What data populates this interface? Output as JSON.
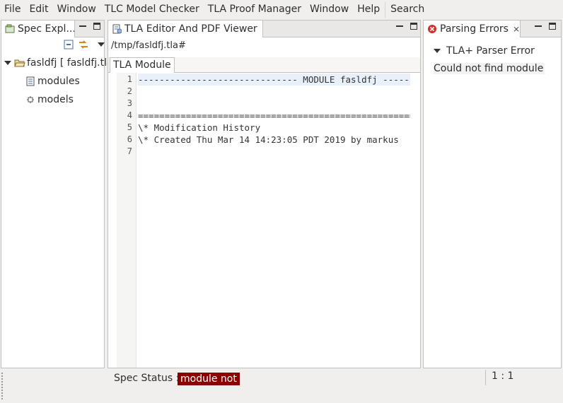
{
  "menubar": {
    "items": [
      "File",
      "Edit",
      "Window",
      "TLC Model Checker",
      "TLA Proof Manager",
      "Window",
      "Help",
      "Search"
    ]
  },
  "spec_explorer": {
    "tab_title": "Spec Expl...",
    "tree": [
      {
        "label": "fasldfj [ fasldfj.tla",
        "expanded": true
      },
      {
        "label": "modules"
      },
      {
        "label": "models"
      }
    ]
  },
  "editor": {
    "tab_title": "TLA Editor And PDF Viewer",
    "close_glyph": "⨯",
    "path": "/tmp/fasldfj.tla#",
    "inner_tab": "TLA Module",
    "lines": [
      {
        "num": "1",
        "text": "------------------------------ MODULE fasldfj ------------------------------"
      },
      {
        "num": "2",
        "text": ""
      },
      {
        "num": "3",
        "text": ""
      },
      {
        "num": "4",
        "text": "============================================================================="
      },
      {
        "num": "5",
        "text": "\\* Modification History"
      },
      {
        "num": "6",
        "text": "\\* Created Thu Mar 14 14:23:05 PDT 2019 by markus"
      },
      {
        "num": "7",
        "text": ""
      }
    ]
  },
  "parsing_errors": {
    "tab_title": "Parsing Errors",
    "group_label": "TLA+ Parser Error",
    "message": "Could not find module"
  },
  "status": {
    "label": "Spec Status :",
    "value": "module not f",
    "cursor": "1 : 1",
    "value_color": "#8b0000"
  }
}
